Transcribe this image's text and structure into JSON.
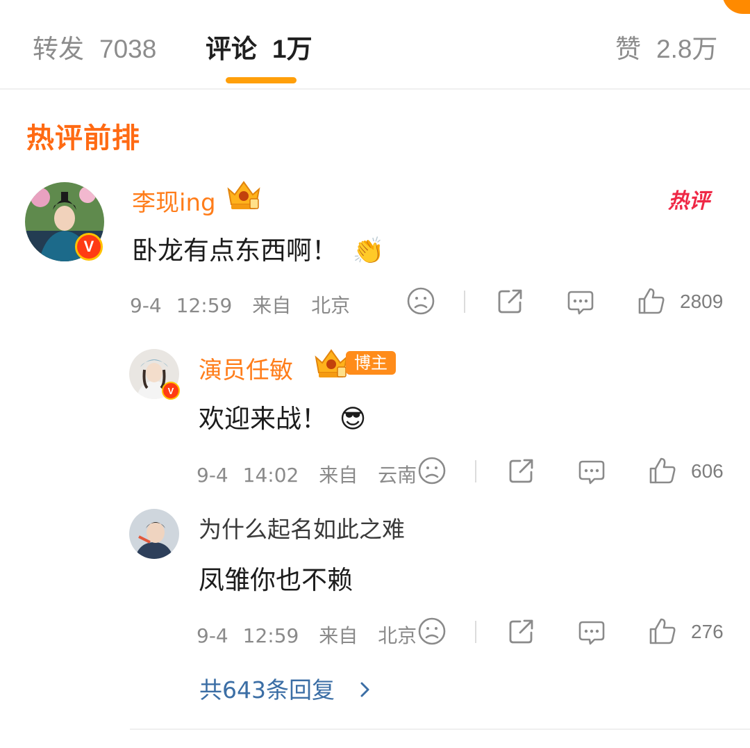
{
  "tabs": {
    "repost_label": "转发",
    "repost_count": "7038",
    "comment_label": "评论",
    "comment_count": "1万",
    "like_label": "赞",
    "like_count": "2.8万"
  },
  "section_title": "热评前排",
  "hot_tag": "热评",
  "comments": [
    {
      "username": "李现ing",
      "text": "卧龙有点东西啊！",
      "emoji": "👏",
      "date": "9-4",
      "time": "12:59",
      "from_label": "来自",
      "location": "北京",
      "likes": "2809"
    },
    {
      "username": "演员任敏",
      "badge": "博主",
      "text": "欢迎来战！",
      "emoji": "😎",
      "date": "9-4",
      "time": "14:02",
      "from_label": "来自",
      "location": "云南",
      "likes": "606"
    },
    {
      "username": "为什么起名如此之难",
      "text": "凤雏你也不赖",
      "date": "9-4",
      "time": "12:59",
      "from_label": "来自",
      "location": "北京",
      "likes": "276"
    }
  ],
  "more_replies": "共643条回复",
  "colors": {
    "accent_orange": "#ff9f0a",
    "username_orange": "#ff7d1a",
    "hot_red": "#ef2846",
    "link_blue": "#3b6ea5"
  },
  "icons": [
    "sad-face-icon",
    "share-icon",
    "comment-icon",
    "thumbs-up-icon",
    "chevron-right-icon",
    "verified-v-icon",
    "crown-badge-icon"
  ]
}
